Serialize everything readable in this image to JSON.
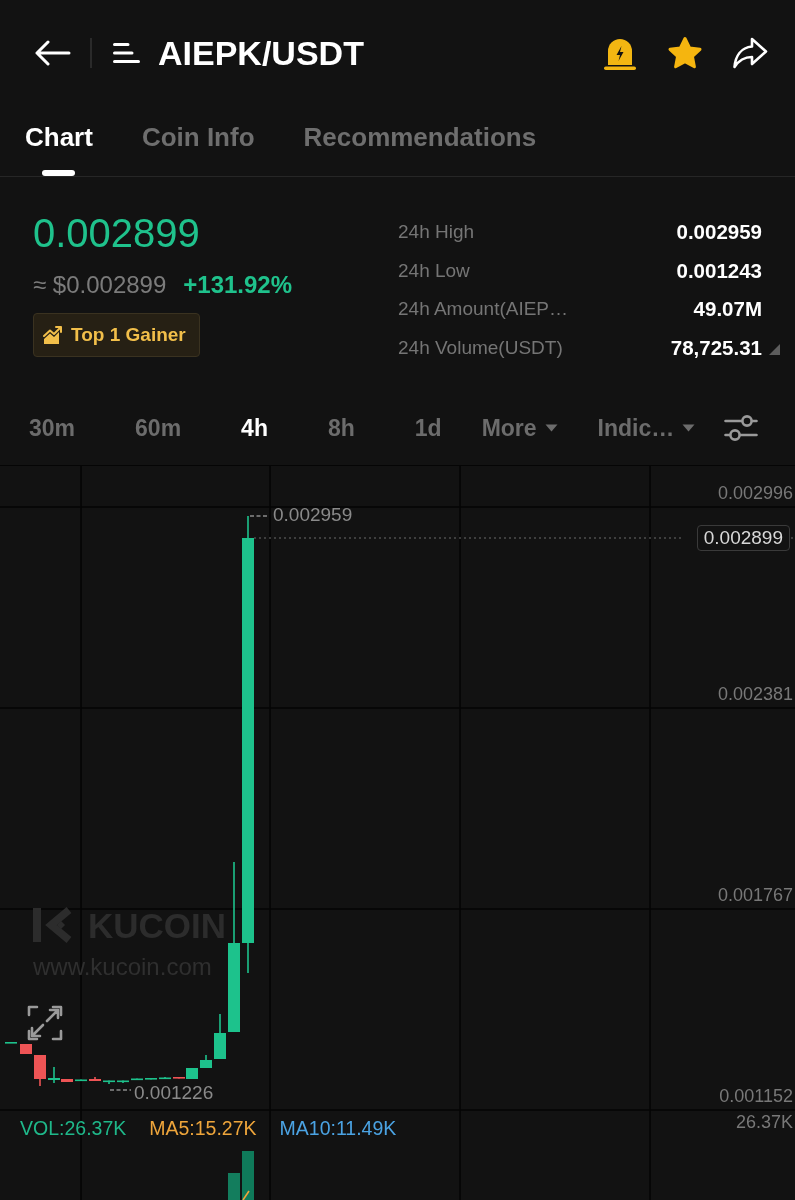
{
  "header": {
    "title": "AIEPK/USDT",
    "favorited": true
  },
  "tabs": [
    {
      "label": "Chart",
      "selected": true
    },
    {
      "label": "Coin Info",
      "selected": false
    },
    {
      "label": "Recommendations",
      "selected": false
    }
  ],
  "ticker": {
    "price": "0.002899",
    "fiat_price": "≈ $0.002899",
    "change": "+131.92%",
    "badge": "Top 1 Gainer"
  },
  "stats": [
    {
      "label": "24h High",
      "value": "0.002959"
    },
    {
      "label": "24h Low",
      "value": "0.001243"
    },
    {
      "label": "24h Amount(AIEP…",
      "value": "49.07M"
    },
    {
      "label": "24h Volume(USDT)",
      "value": "78,725.31"
    }
  ],
  "intervals": [
    {
      "label": "30m",
      "kind": "interval",
      "selected": false
    },
    {
      "label": "60m",
      "kind": "interval",
      "selected": false
    },
    {
      "label": "4h",
      "kind": "interval",
      "selected": true
    },
    {
      "label": "8h",
      "kind": "interval",
      "selected": false
    },
    {
      "label": "1d",
      "kind": "interval",
      "selected": false
    },
    {
      "label": "More",
      "kind": "dropdown",
      "selected": false
    },
    {
      "label": "Indic…",
      "kind": "dropdown",
      "selected": false
    }
  ],
  "chart": {
    "price_axis": [
      "0.002996",
      "0.002381",
      "0.001767",
      "0.001152"
    ],
    "last_price": "0.002899",
    "high_marker": "0.002959",
    "low_marker": "0.001226",
    "watermark": {
      "brand": "KUCOIN",
      "url": "www.kucoin.com"
    },
    "indicators": [
      {
        "label": "VOL:26.37K",
        "color": "#1fb88a"
      },
      {
        "label": "MA5:15.27K",
        "color": "#eea53b"
      },
      {
        "label": "MA10:11.49K",
        "color": "#4ba3e3"
      }
    ],
    "volume_axis": "26.37K"
  }
}
